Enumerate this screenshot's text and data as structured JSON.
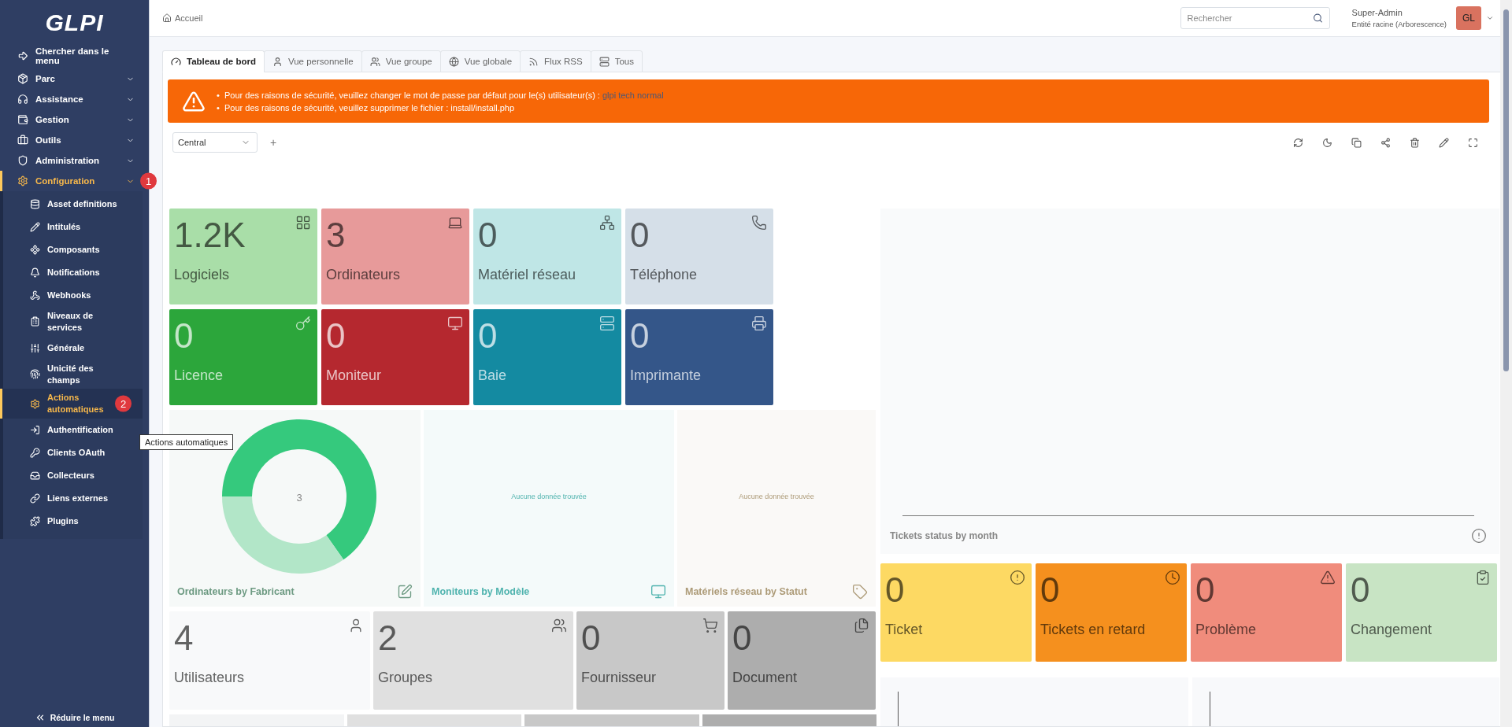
{
  "sidebar": {
    "logo": "GLPI",
    "search_entry": "Chercher dans le menu",
    "items": [
      {
        "label": "Parc",
        "expanded": false,
        "selected": false
      },
      {
        "label": "Assistance",
        "expanded": false,
        "selected": false
      },
      {
        "label": "Gestion",
        "expanded": false,
        "selected": false
      },
      {
        "label": "Outils",
        "expanded": false,
        "selected": false
      },
      {
        "label": "Administration",
        "expanded": false,
        "selected": false
      },
      {
        "label": "Configuration",
        "expanded": true,
        "selected": true,
        "annotation": "1",
        "children": [
          {
            "label": "Asset definitions",
            "selected": false
          },
          {
            "label": "Intitulés",
            "selected": false
          },
          {
            "label": "Composants",
            "selected": false
          },
          {
            "label": "Notifications",
            "selected": false
          },
          {
            "label": "Webhooks",
            "selected": false
          },
          {
            "label": "Niveaux de services",
            "selected": false
          },
          {
            "label": "Générale",
            "selected": false
          },
          {
            "label": "Unicité des champs",
            "selected": false
          },
          {
            "label": "Actions automatiques",
            "selected": true,
            "annotation": "2"
          },
          {
            "label": "Authentification",
            "selected": false
          },
          {
            "label": "Clients OAuth",
            "selected": false
          },
          {
            "label": "Collecteurs",
            "selected": false
          },
          {
            "label": "Liens externes",
            "selected": false
          },
          {
            "label": "Plugins",
            "selected": false
          }
        ]
      }
    ],
    "collapse": "Réduire le menu"
  },
  "tooltip": "Actions automatiques",
  "topbar": {
    "breadcrumb": "Accueil",
    "search": {
      "placeholder": "Rechercher"
    },
    "user": {
      "name": "Super-Admin",
      "entity": "Entité racine (Arborescence)",
      "initials": "GL"
    }
  },
  "tabs": [
    {
      "label": "Tableau de bord",
      "selected": true
    },
    {
      "label": "Vue personnelle",
      "selected": false
    },
    {
      "label": "Vue groupe",
      "selected": false
    },
    {
      "label": "Vue globale",
      "selected": false
    },
    {
      "label": "Flux RSS",
      "selected": false
    },
    {
      "label": "Tous",
      "selected": false
    }
  ],
  "alerts": [
    {
      "bullet": "•",
      "text": "Pour des raisons de sécurité, veuillez changer le mot de passe par défaut pour le(s) utilisateur(s) :",
      "link": "glpi tech normal"
    },
    {
      "bullet": "•",
      "text": "Pour des raisons de sécurité, veuillez supprimer le fichier : install/install.php"
    }
  ],
  "dashboard": {
    "selected": "Central",
    "add": "+"
  },
  "asset_cards": [
    {
      "value": "1.2K",
      "label": "Logiciels",
      "color": "#a9dea8"
    },
    {
      "value": "3",
      "label": "Ordinateurs",
      "color": "#e79a9a"
    },
    {
      "value": "0",
      "label": "Matériel réseau",
      "color": "#bfe6e6"
    },
    {
      "value": "0",
      "label": "Téléphone",
      "color": "#d5dfe8"
    },
    {
      "value": "0",
      "label": "Licence",
      "color": "#2ca63b"
    },
    {
      "value": "0",
      "label": "Moniteur",
      "color": "#b5282f"
    },
    {
      "value": "0",
      "label": "Baie",
      "color": "#148aa1"
    },
    {
      "value": "0",
      "label": "Imprimante",
      "color": "#345689"
    }
  ],
  "widgets": [
    {
      "kind": "donut",
      "title": "Ordinateurs by Fabricant",
      "center": "3",
      "color": "#6d9a82"
    },
    {
      "kind": "empty",
      "title": "Moniteurs by Modèle",
      "message": "Aucune donnée trouvée",
      "color": "#4fb3ae"
    },
    {
      "kind": "empty",
      "title": "Matériels réseau by Statut",
      "message": "Aucune donnée trouvée",
      "color": "#ad9b78"
    }
  ],
  "count_cards": [
    {
      "value": "4",
      "label": "Utilisateurs",
      "color": "#f8f9fa"
    },
    {
      "value": "2",
      "label": "Groupes",
      "color": "#e0e0e0"
    },
    {
      "value": "0",
      "label": "Fournisseur",
      "color": "#c8c8c8"
    },
    {
      "value": "0",
      "label": "Document",
      "color": "#adadad"
    }
  ],
  "ticket_chart": {
    "title": "Tickets status by month"
  },
  "ticket_cards": [
    {
      "value": "0",
      "label": "Ticket",
      "color": "#fdd963"
    },
    {
      "value": "0",
      "label": "Tickets en retard",
      "color": "#f5901e"
    },
    {
      "value": "0",
      "label": "Problème",
      "color": "#f08c7c"
    },
    {
      "value": "0",
      "label": "Changement",
      "color": "#c8e4c4"
    }
  ]
}
